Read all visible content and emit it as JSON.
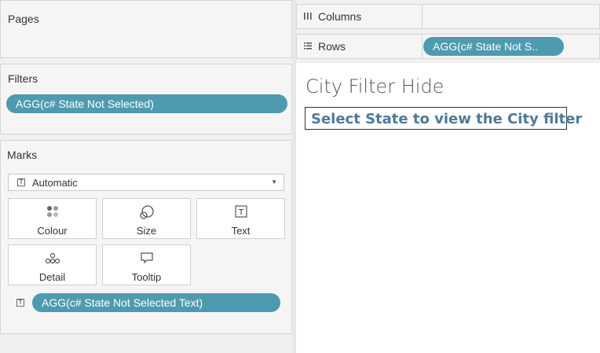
{
  "pages": {
    "title": "Pages"
  },
  "filters": {
    "title": "Filters",
    "pill": "AGG(c# State Not Selected)"
  },
  "marks": {
    "title": "Marks",
    "mark_type": "Automatic",
    "buttons": [
      {
        "label": "Colour",
        "icon": "colour-icon"
      },
      {
        "label": "Size",
        "icon": "size-icon"
      },
      {
        "label": "Text",
        "icon": "text-icon"
      },
      {
        "label": "Detail",
        "icon": "detail-icon"
      },
      {
        "label": "Tooltip",
        "icon": "tooltip-icon"
      }
    ],
    "text_pill": "AGG(c# State Not Selected Text)"
  },
  "shelves": {
    "columns": {
      "label": "Columns",
      "icon": "columns-icon"
    },
    "rows": {
      "label": "Rows",
      "icon": "rows-icon",
      "pill": "AGG(c# State Not S.."
    }
  },
  "view": {
    "title": "City Filter Hide",
    "message": "Select State to view the City filter"
  },
  "colors": {
    "pill": "#4e9bb0",
    "message_text": "#4e7a99"
  }
}
